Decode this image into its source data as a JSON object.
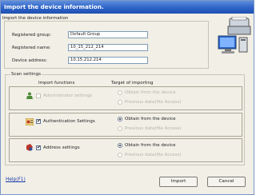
{
  "window": {
    "title": "Import the device information."
  },
  "info": {
    "section_label": "Import the device information",
    "registered_group_label": "Registered group:",
    "registered_group_value": "Default Group",
    "registered_name_label": "Registered name:",
    "registered_name_value": "10_15_212_214",
    "device_address_label": "Device address:",
    "device_address_value": "10.15.212.214"
  },
  "scan": {
    "group_label": "Scan settings",
    "col_functions": "Import functions",
    "col_target": "Target of importing",
    "rows": [
      {
        "label": "Administrator settings",
        "checked": false,
        "enabled": false,
        "opt1": "Obtain from the device",
        "opt2": "Previous data(file Access)",
        "selected": 1
      },
      {
        "label": "Authentication Settings",
        "checked": true,
        "enabled": true,
        "opt1": "Obtain from the device",
        "opt2": "Previous data(file Access)",
        "selected": 1
      },
      {
        "label": "Address settings",
        "checked": true,
        "enabled": true,
        "opt1": "Obtain from the device",
        "opt2": "Previous data(file Access)",
        "selected": 1
      }
    ]
  },
  "footer": {
    "help_label": "Help(F1)",
    "import_label": "Import",
    "cancel_label": "Cancel"
  },
  "icons": {
    "device_graphic": "printer-computer-icon",
    "row_icons": [
      "administrator-icon",
      "authentication-icon",
      "address-book-icon"
    ]
  },
  "colors": {
    "title_bar": "#2d63c8",
    "dialog_bg": "#f1efe6",
    "link": "#1b39a8"
  }
}
